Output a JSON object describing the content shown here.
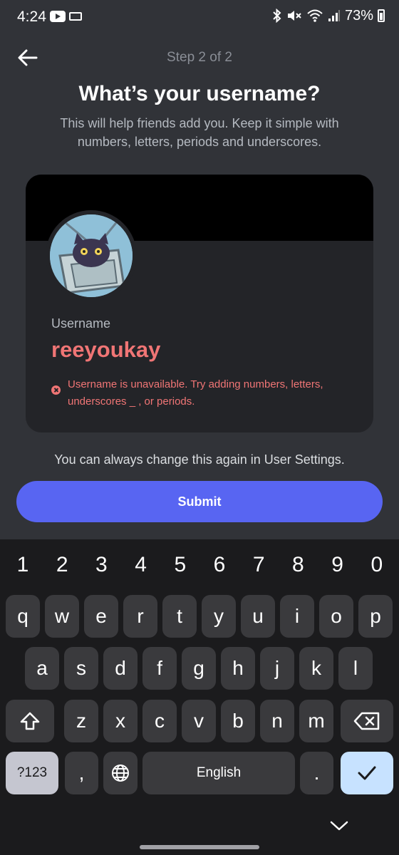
{
  "status_bar": {
    "time": "4:24",
    "battery": "73%",
    "icons": [
      "youtube-icon",
      "keyboard-icon",
      "bluetooth-icon",
      "mute-icon",
      "wifi-icon",
      "signal-icon",
      "battery-icon"
    ]
  },
  "header": {
    "step": "Step 2 of 2",
    "title": "What’s your username?",
    "subtitle": "This will help friends add you. Keep it simple with numbers, letters, periods and underscores."
  },
  "profile": {
    "username_label": "Username",
    "username": "reeyoukay",
    "error": "Username is unavailable. Try adding numbers, letters, underscores _ , or periods.",
    "colors": {
      "error": "#f07575",
      "banner": "#000000"
    }
  },
  "footer": {
    "note": "You can always change this again in User Settings.",
    "submit_label": "Submit"
  },
  "keyboard": {
    "number_row": [
      "1",
      "2",
      "3",
      "4",
      "5",
      "6",
      "7",
      "8",
      "9",
      "0"
    ],
    "row1": [
      "q",
      "w",
      "e",
      "r",
      "t",
      "y",
      "u",
      "i",
      "o",
      "p"
    ],
    "row2": [
      "a",
      "s",
      "d",
      "f",
      "g",
      "h",
      "j",
      "k",
      "l"
    ],
    "row3": [
      "z",
      "x",
      "c",
      "v",
      "b",
      "n",
      "m"
    ],
    "numsym_label": "?123",
    "comma_label": ",",
    "space_label": "English",
    "period_label": "."
  },
  "accent": "#5865f2"
}
